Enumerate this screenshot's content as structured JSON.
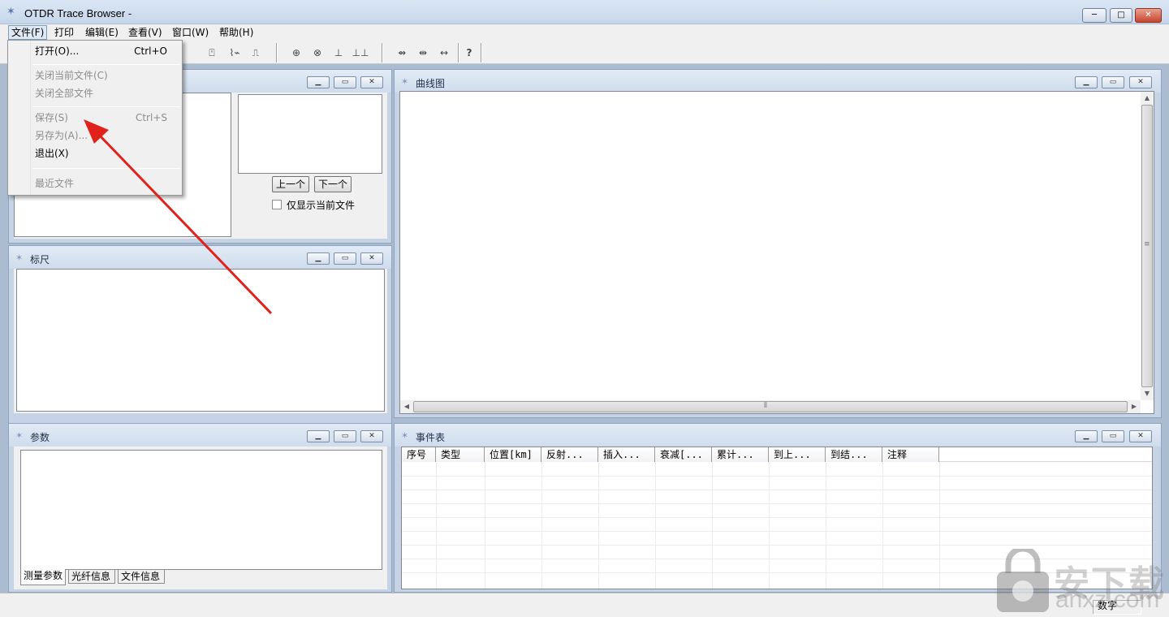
{
  "window": {
    "title": "OTDR Trace Browser -",
    "minimize_label": "─",
    "maximize_label": "□",
    "close_label": "✕"
  },
  "menubar": [
    {
      "label": "文件(F)"
    },
    {
      "label": "打印"
    },
    {
      "label": "编辑(E)"
    },
    {
      "label": "查看(V)"
    },
    {
      "label": "窗口(W)"
    },
    {
      "label": "帮助(H)"
    }
  ],
  "file_menu": {
    "open": {
      "label": "打开(O)...",
      "shortcut": "Ctrl+O"
    },
    "close_current": {
      "label": "关闭当前文件(C)"
    },
    "close_all": {
      "label": "关闭全部文件"
    },
    "save": {
      "label": "保存(S)",
      "shortcut": "Ctrl+S"
    },
    "save_as": {
      "label": "另存为(A)..."
    },
    "exit": {
      "label": "退出(X)"
    },
    "recent": {
      "label": "最近文件"
    }
  },
  "toolbar": {
    "help_glyph": "?"
  },
  "file_list_panel": {
    "prev_label": "上一个",
    "next_label": "下一个",
    "only_current_label": "仅显示当前文件"
  },
  "ruler_panel": {
    "title": "标尺"
  },
  "params_panel": {
    "title": "参数",
    "tabs": [
      "测量参数",
      "光纤信息",
      "文件信息"
    ]
  },
  "curve_panel": {
    "title": "曲线图"
  },
  "event_panel": {
    "title": "事件表",
    "columns": [
      "序号",
      "类型",
      "位置[km]",
      "反射...",
      "插入...",
      "衰减[...",
      "累计...",
      "到上...",
      "到结...",
      "注释"
    ]
  },
  "statusbar": {
    "mode": "数字"
  },
  "watermark": {
    "text": "安下载",
    "url": "anxz.com"
  },
  "colors": {
    "arrow": "#e0221b",
    "title_bar": "#dbe7f5",
    "mdi_background": "#abbbd0"
  }
}
